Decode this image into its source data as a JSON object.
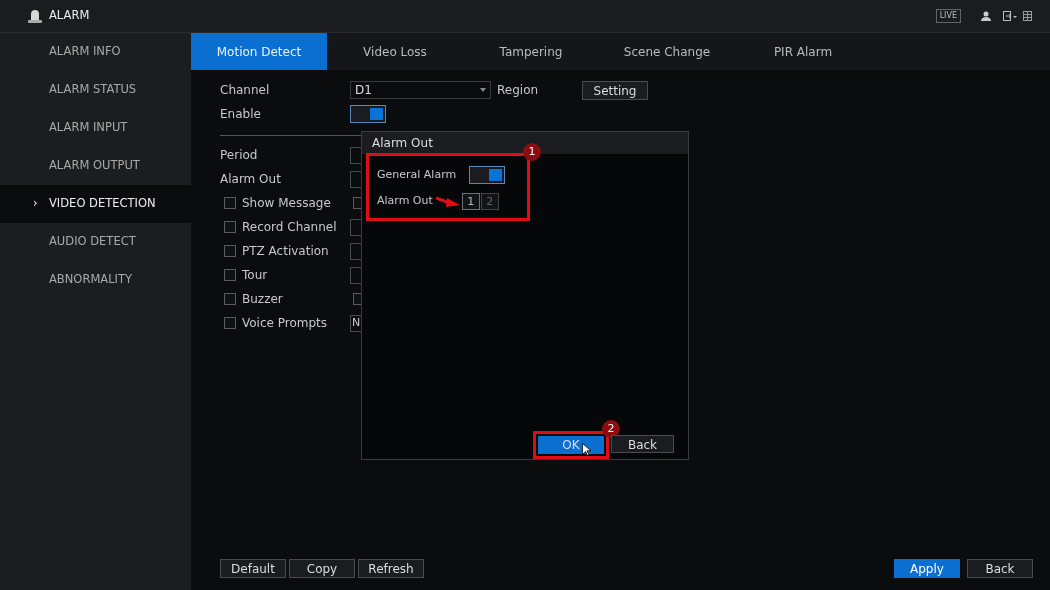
{
  "window": {
    "title": "ALARM"
  },
  "header_icons": {
    "live_badge": "LIVE"
  },
  "sidebar": {
    "items": [
      {
        "label": "ALARM INFO",
        "selected": false
      },
      {
        "label": "ALARM STATUS",
        "selected": false
      },
      {
        "label": "ALARM INPUT",
        "selected": false
      },
      {
        "label": "ALARM OUTPUT",
        "selected": false
      },
      {
        "label": "VIDEO DETECTION",
        "selected": true,
        "marker": "›"
      },
      {
        "label": "AUDIO DETECT",
        "selected": false
      },
      {
        "label": "ABNORMALITY",
        "selected": false
      }
    ]
  },
  "tabs": [
    {
      "label": "Motion Detect",
      "selected": true
    },
    {
      "label": "Video Loss",
      "selected": false
    },
    {
      "label": "Tampering",
      "selected": false
    },
    {
      "label": "Scene Change",
      "selected": false
    },
    {
      "label": "PIR Alarm",
      "selected": false
    }
  ],
  "form": {
    "channel": {
      "label": "Channel",
      "value": "D1"
    },
    "region": {
      "label": "Region",
      "button": "Setting"
    },
    "enable": {
      "label": "Enable",
      "on": true
    },
    "period": {
      "label": "Period"
    },
    "alarm_out": {
      "label": "Alarm Out"
    },
    "options": [
      {
        "label": "Show Message",
        "checked": false,
        "control": {
          "kind": "checkbox",
          "checked": false
        }
      },
      {
        "label": "Record Channel",
        "checked": false,
        "control": {
          "kind": "button"
        }
      },
      {
        "label": "PTZ Activation",
        "checked": false,
        "control": {
          "kind": "button"
        }
      },
      {
        "label": "Tour",
        "checked": false,
        "control": {
          "kind": "button"
        }
      },
      {
        "label": "Buzzer",
        "checked": false,
        "control": {
          "kind": "checkbox",
          "checked": false
        }
      },
      {
        "label": "Voice Prompts",
        "checked": false,
        "control": {
          "kind": "select",
          "value": "N"
        }
      }
    ]
  },
  "dialog": {
    "title": "Alarm Out",
    "callout": "1",
    "general_alarm": {
      "label": "General Alarm",
      "on": true
    },
    "alarm_out": {
      "label": "Alarm Out",
      "outputs": [
        {
          "label": "1",
          "selected": true
        },
        {
          "label": "2",
          "selected": false
        }
      ]
    },
    "ok_button": {
      "label": "OK",
      "callout": "2"
    },
    "back_button": "Back"
  },
  "footer": {
    "left_buttons": [
      "Default",
      "Copy",
      "Refresh"
    ],
    "apply": "Apply",
    "back": "Back"
  }
}
